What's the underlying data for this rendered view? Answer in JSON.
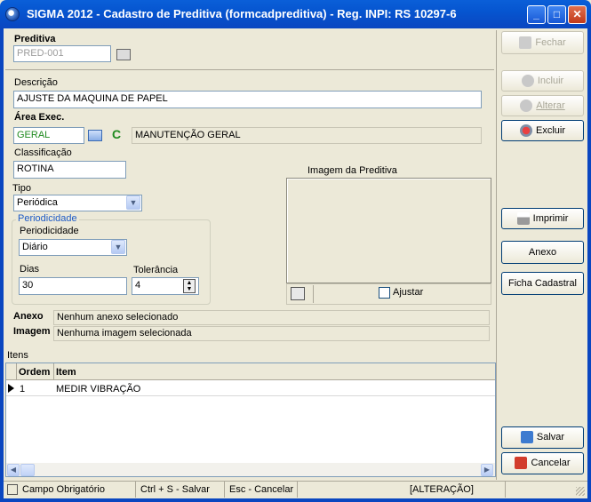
{
  "window": {
    "title": "SIGMA 2012 - Cadastro de Preditiva  (formcadpreditiva)  - Reg. INPI: RS 10297-6",
    "minimize": "_",
    "maximize": "□",
    "close": "✕"
  },
  "form": {
    "preditiva_label": "Preditiva",
    "preditiva_value": "PRED-001",
    "descricao_label": "Descrição",
    "descricao_value": "AJUSTE DA MAQUINA DE PAPEL",
    "area_label": "Área Exec.",
    "area_code": "GERAL",
    "area_refresh": "C",
    "area_desc": "MANUTENÇÃO GERAL",
    "classificacao_label": "Classificação",
    "classificacao_value": "ROTINA",
    "tipo_label": "Tipo",
    "tipo_value": "Periódica",
    "periodicidade_group": "Periodicidade",
    "periodicidade_label": "Periodicidade",
    "periodicidade_value": "Diário",
    "dias_label": "Dias",
    "dias_value": "30",
    "tolerancia_label": "Tolerância",
    "tolerancia_value": "4",
    "imagem_title": "Imagem da Preditiva",
    "ajustar_label": "Ajustar",
    "anexo_label": "Anexo",
    "anexo_value": "Nenhum anexo selecionado",
    "imagem_label": "Imagem",
    "imagem_value": "Nenhuma imagem selecionada",
    "itens_label": "Itens"
  },
  "grid": {
    "columns": [
      "Ordem",
      "Item"
    ],
    "rows": [
      {
        "ordem": "1",
        "item": "MEDIR VIBRAÇÃO"
      }
    ]
  },
  "buttons": {
    "fechar": "Fechar",
    "incluir": "Incluir",
    "alterar": "Alterar",
    "excluir": "Excluir",
    "imprimir": "Imprimir",
    "anexo": "Anexo",
    "ficha": "Ficha Cadastral",
    "salvar": "Salvar",
    "cancelar": "Cancelar"
  },
  "status": {
    "obrigatorio": "Campo Obrigatório",
    "salvar_hint": "Ctrl + S - Salvar",
    "cancelar_hint": "Esc - Cancelar",
    "mode": "[ALTERAÇÃO]"
  },
  "colors": {
    "titlebar": "#0A5FD8",
    "background": "#ECE9D8",
    "green_text": "#1F8A1F",
    "group_title": "#1E5BC6"
  }
}
